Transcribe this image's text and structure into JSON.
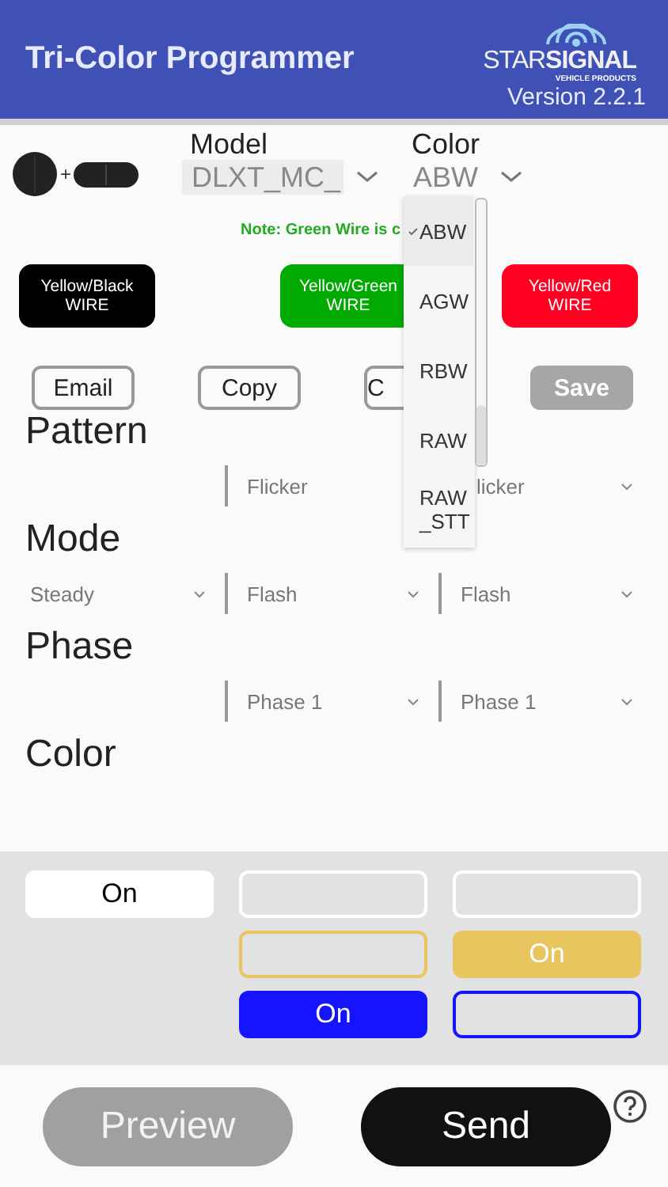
{
  "header": {
    "title": "Tri-Color Programmer",
    "logo": {
      "light": "STAR",
      "bold": "SIGNAL",
      "sub": "VEHICLE PRODUCTS"
    },
    "version": "Version 2.2.1"
  },
  "device": {
    "plus": "+"
  },
  "model": {
    "label": "Model",
    "value": "DLXT_MC_"
  },
  "color_select": {
    "label": "Color",
    "value": "ABW",
    "expanded": true,
    "options": [
      {
        "label": "ABW",
        "selected": true
      },
      {
        "label": "AGW",
        "selected": false
      },
      {
        "label": "RBW",
        "selected": false
      },
      {
        "label": "RAW",
        "selected": false
      },
      {
        "label": "RAW\n_STT",
        "selected": false
      }
    ]
  },
  "note": "Note: Green Wire is c",
  "wires": [
    {
      "label": "Yellow/Black",
      "sub": "WIRE",
      "color": "#000000"
    },
    {
      "label": "Yellow/Green",
      "sub": "WIRE",
      "color": "#00aa00"
    },
    {
      "label": "Yellow/Red",
      "sub": "WIRE",
      "color": "#ff0022"
    }
  ],
  "actions": [
    {
      "label": "Email",
      "kind": "outline"
    },
    {
      "label": "Copy",
      "kind": "outline"
    },
    {
      "label": "C",
      "kind": "partial"
    },
    {
      "label": "Save",
      "kind": "filled"
    }
  ],
  "sections": [
    {
      "title": "Pattern",
      "cells": [
        {
          "kind": "empty"
        },
        {
          "kind": "select",
          "value": "Flicker",
          "chevron": false
        },
        {
          "kind": "partial",
          "value": "licker",
          "chevron": true
        }
      ]
    },
    {
      "title": "Mode",
      "cells": [
        {
          "kind": "select",
          "value": "Steady",
          "chevron": true
        },
        {
          "kind": "select",
          "value": "Flash",
          "chevron": true
        },
        {
          "kind": "select",
          "value": "Flash",
          "chevron": true
        }
      ]
    },
    {
      "title": "Phase",
      "cells": [
        {
          "kind": "empty"
        },
        {
          "kind": "select",
          "value": "Phase 1",
          "chevron": true
        },
        {
          "kind": "select",
          "value": "Phase 1",
          "chevron": true
        }
      ]
    },
    {
      "title": "Color"
    }
  ],
  "color_grid": [
    [
      {
        "kind": "toggle",
        "on": true,
        "label": "On",
        "color": "#ffffff"
      },
      {
        "kind": "toggle",
        "on": false,
        "color": "#ffffff"
      },
      {
        "kind": "toggle",
        "on": false,
        "color": "#ffffff"
      }
    ],
    [
      {
        "kind": "empty"
      },
      {
        "kind": "toggle",
        "on": false,
        "color": "#e8c55e"
      },
      {
        "kind": "toggle",
        "on": true,
        "label": "On",
        "color": "#e8c55e"
      }
    ],
    [
      {
        "kind": "empty"
      },
      {
        "kind": "toggle",
        "on": true,
        "label": "On",
        "color": "#1414ff"
      },
      {
        "kind": "toggle",
        "on": false,
        "color": "#1414ff"
      }
    ]
  ],
  "footer": [
    {
      "label": "Preview",
      "disabled": true
    },
    {
      "label": "Send",
      "disabled": false
    }
  ]
}
